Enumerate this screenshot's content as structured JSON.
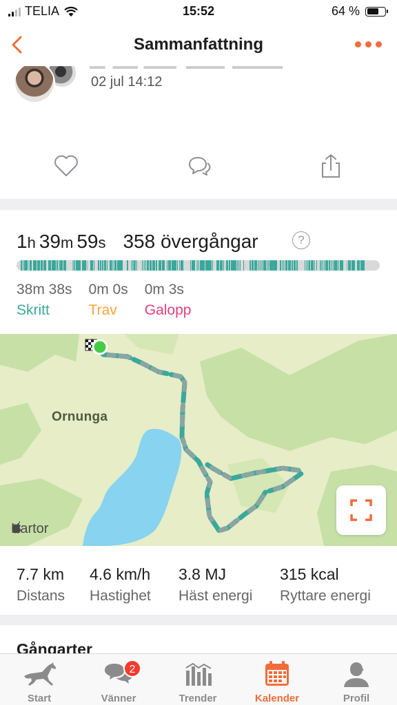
{
  "status_bar": {
    "carrier": "TELIA",
    "time": "15:52",
    "battery_percent": "64 %",
    "battery_level": 0.64
  },
  "nav": {
    "title": "Sammanfattning"
  },
  "post": {
    "date": "02 jul 14:12"
  },
  "summary": {
    "hours": "1",
    "hours_unit": "h",
    "minutes": "39",
    "minutes_unit": "m",
    "seconds": "59",
    "seconds_unit": "s",
    "transitions": "358 övergångar",
    "help": "?"
  },
  "gaits": [
    {
      "time": "38m 38s",
      "name": "Skritt",
      "color": "#3aa89c"
    },
    {
      "time": "0m 0s",
      "name": "Trav",
      "color": "#f5a63a"
    },
    {
      "time": "0m 3s",
      "name": "Galopp",
      "color": "#e0417a"
    }
  ],
  "map": {
    "place_label": "Ornunga",
    "attribution": "Kartor"
  },
  "stats": [
    {
      "value": "7.7 km",
      "label": "Distans"
    },
    {
      "value": "4.6 km/h",
      "label": "Hastighet"
    },
    {
      "value": "3.8 MJ",
      "label": "Häst energi"
    },
    {
      "value": "315 kcal",
      "label": "Ryttare energi"
    }
  ],
  "section": {
    "title": "Gångarter"
  },
  "tabs": [
    {
      "label": "Start",
      "icon": "horse-icon"
    },
    {
      "label": "Vänner",
      "icon": "chat-icon",
      "badge": "2"
    },
    {
      "label": "Trender",
      "icon": "bar-chart-icon"
    },
    {
      "label": "Kalender",
      "icon": "calendar-icon",
      "active": true
    },
    {
      "label": "Profil",
      "icon": "profile-icon"
    }
  ],
  "colors": {
    "accent": "#f06c3a",
    "walk": "#3aa89c",
    "trot": "#f5a63a",
    "canter": "#e0417a",
    "badge": "#f23b2e"
  }
}
